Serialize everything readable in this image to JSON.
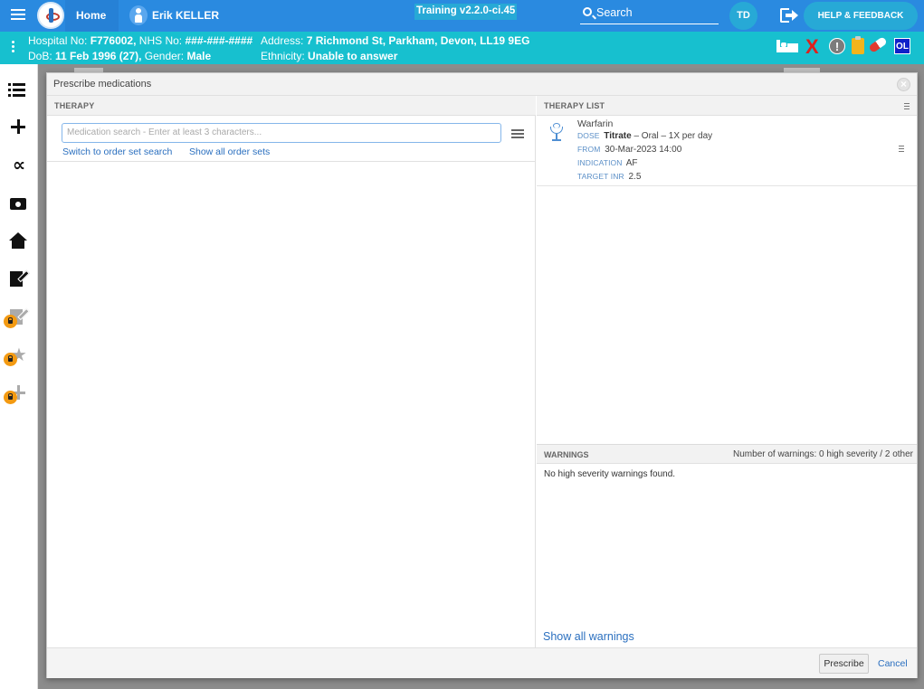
{
  "topbar": {
    "home_label": "Home",
    "patient_name": "Erik KELLER",
    "training_label": "Training v2.2.0-ci.45",
    "search_label": "Search",
    "user_initials": "TD",
    "help_label": "HELP & FEEDBACK"
  },
  "patient_banner": {
    "hospital_label": "Hospital No:",
    "hospital_no": "F776002,",
    "nhs_label": "NHS No:",
    "nhs_no": "###-###-####",
    "address_label": "Address:",
    "address": "7 Richmond St, Parkham, Devon, LL19 9EG",
    "dob_label": "DoB:",
    "dob": "11 Feb 1996 (27),",
    "gender_label": "Gender:",
    "gender": "Male",
    "ethnicity_label": "Ethnicity:",
    "ethnicity": "Unable to answer",
    "icons": [
      "bed-icon",
      "allergy-x-icon",
      "alert-icon",
      "clipboard-icon",
      "pill-icon"
    ],
    "ol_badge": "OL"
  },
  "sidebar": {
    "items": [
      "list-icon",
      "plus-icon",
      "stethoscope-icon",
      "camera-icon",
      "home-icon",
      "document-edit-icon",
      "locked-clipboard-icon",
      "locked-walk-icon",
      "locked-plus-icon"
    ]
  },
  "dialog": {
    "title": "Prescribe medications",
    "therapy_header": "THERAPY",
    "search_placeholder": "Medication search - Enter at least 3 characters...",
    "switch_link": "Switch to order set search",
    "show_sets_link": "Show all order sets",
    "therapy_list_header": "THERAPY LIST",
    "therapy_item": {
      "name": "Warfarin",
      "dose_key": "DOSE",
      "dose_value_bold": "Titrate",
      "dose_rest": " – Oral – 1X per day",
      "from_key": "FROM",
      "from_value": "30-Mar-2023 14:00",
      "indication_key": "INDICATION",
      "indication_value": "AF",
      "target_key": "TARGET INR",
      "target_value": "2.5"
    },
    "warnings_header": "WARNINGS",
    "warnings_count": "Number of warnings: 0 high severity / 2 other",
    "no_warnings": "No high severity warnings found.",
    "show_all_warnings": "Show all warnings",
    "prescribe_button": "Prescribe",
    "cancel_button": "Cancel"
  },
  "colors": {
    "topbar": "#2a8ae0",
    "patient_banner": "#17c0cf",
    "link": "#2a6fbf",
    "lock_badge": "#f39a12"
  }
}
